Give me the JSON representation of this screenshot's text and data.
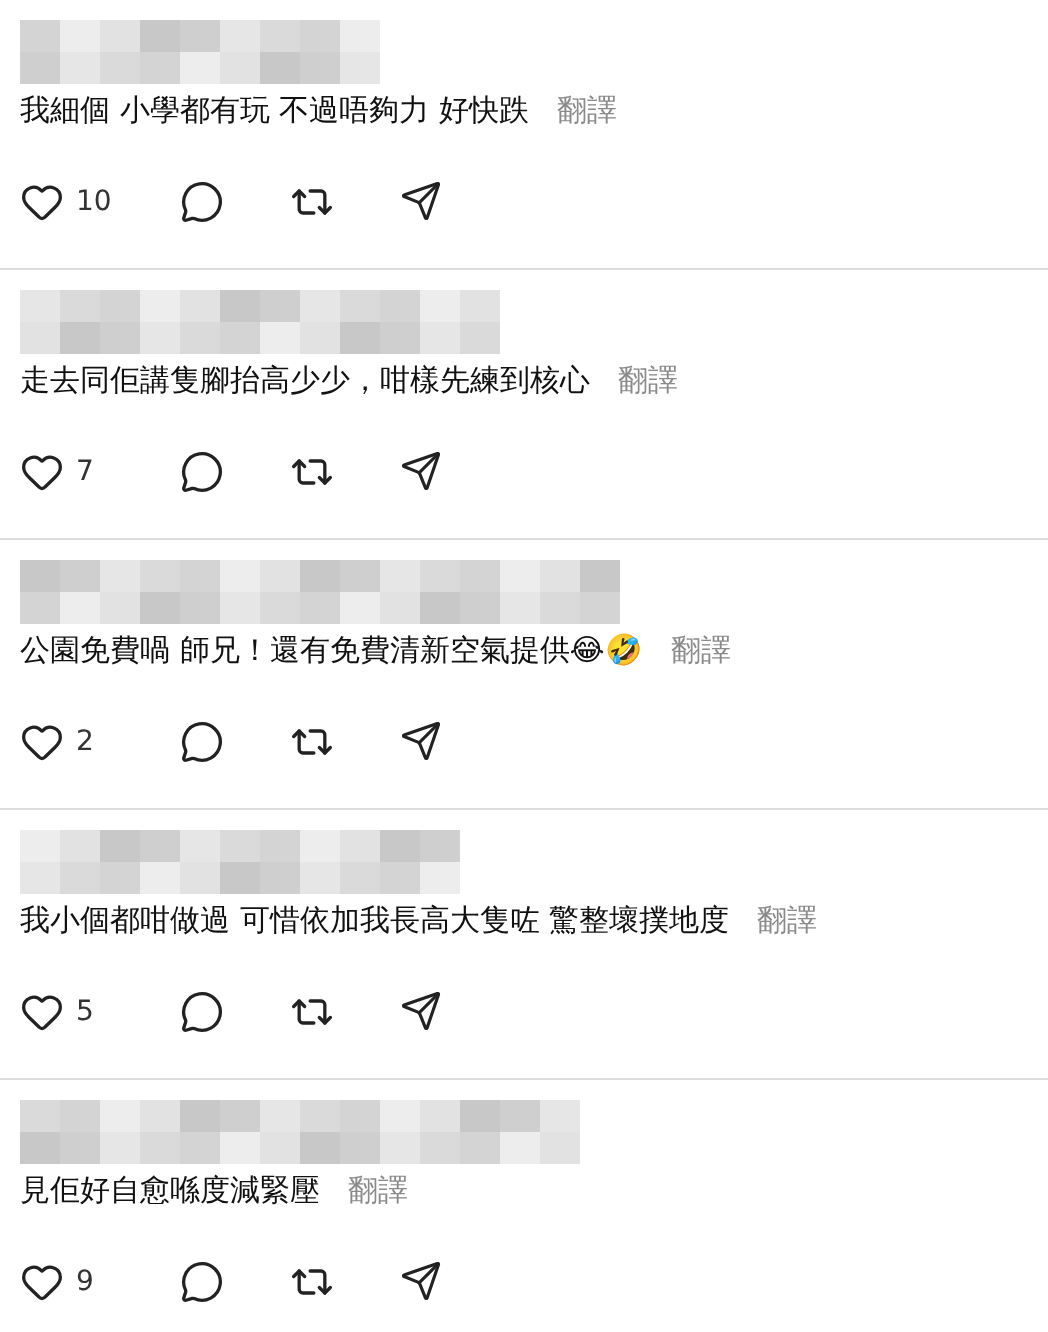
{
  "comments": [
    {
      "text": "我細個 小學都有玩 不過唔夠力 好快跌",
      "translate": "翻譯",
      "likes": "10"
    },
    {
      "text": "走去同佢講隻腳抬高少少，咁樣先練到核心",
      "translate": "翻譯",
      "likes": "7"
    },
    {
      "text": "公園免費喎 師兄！還有免費清新空氣提供😂🤣",
      "translate": "翻譯",
      "likes": "2"
    },
    {
      "text": "我小個都咁做過 可惜依加我長高大隻咗 驚整壞撲地度",
      "translate": "翻譯",
      "likes": "5"
    },
    {
      "text": "見佢好自愈喺度減緊壓",
      "translate": "翻譯",
      "likes": "9"
    }
  ]
}
